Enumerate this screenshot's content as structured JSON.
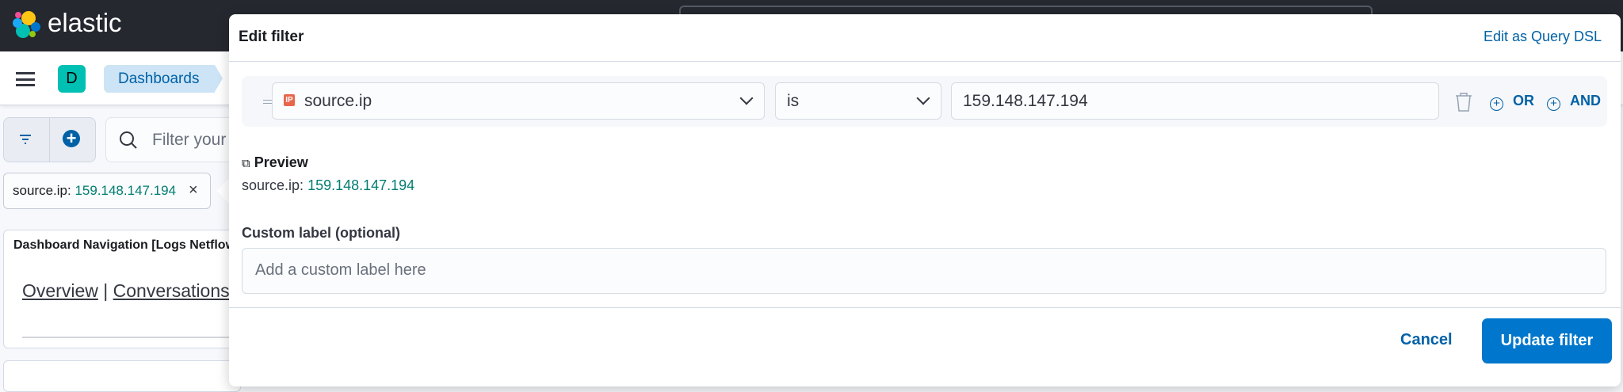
{
  "app": {
    "brand": "elastic"
  },
  "nav": {
    "avatar": "D",
    "breadcrumb": "Dashboards"
  },
  "query": {
    "placeholder": "Filter your"
  },
  "pill": {
    "field": "source.ip:",
    "value": "159.148.147.194"
  },
  "panels": [
    {
      "title": "Dashboard Navigation [Logs Netflow]",
      "links": [
        "Overview",
        "Conversations"
      ]
    }
  ],
  "popover": {
    "title": "Edit filter",
    "dsl_link": "Edit as Query DSL",
    "field": "source.ip",
    "field_type": "IP",
    "operator": "is",
    "value": "159.148.147.194",
    "or_label": "OR",
    "and_label": "AND",
    "preview_heading": "Preview",
    "preview_field": "source.ip:",
    "preview_value": "159.148.147.194",
    "custom_label": "Custom label (optional)",
    "custom_label_placeholder": "Add a custom label here",
    "cancel": "Cancel",
    "update": "Update filter"
  },
  "colors": {
    "accent": "#0077cc",
    "link": "#0061a6",
    "value": "#017d73",
    "header": "#25282f"
  }
}
